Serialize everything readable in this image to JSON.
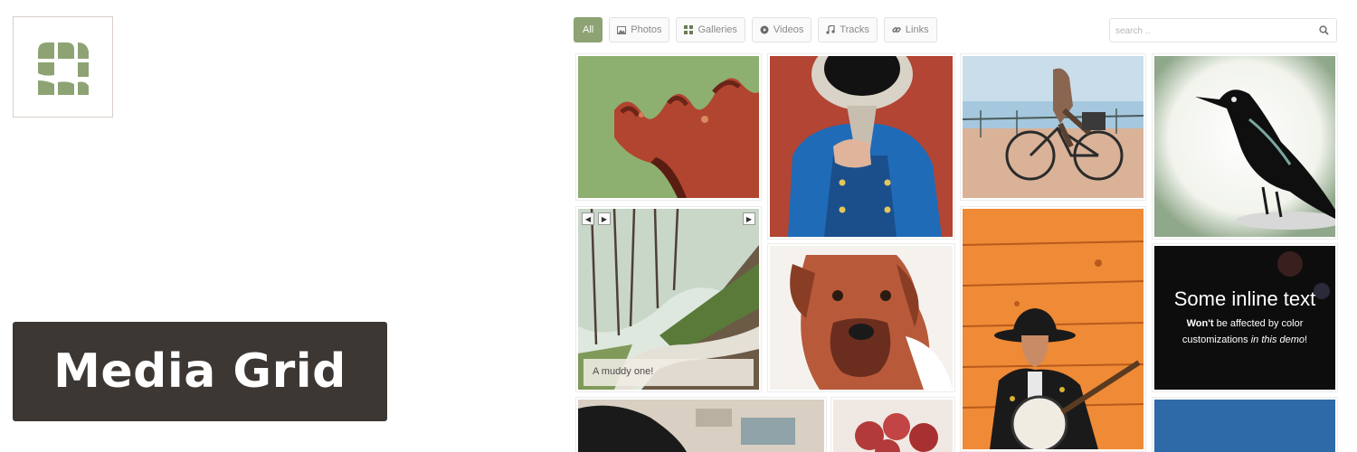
{
  "brand": {
    "title": "Media Grid",
    "logo_icon": "grid-of-rounded-squares-icon",
    "logo_color": "#8ea373",
    "plate_color": "#3c3733"
  },
  "filters": {
    "items": [
      {
        "label": "All",
        "icon": "",
        "active": true
      },
      {
        "label": "Photos",
        "icon": "photo-icon",
        "active": false
      },
      {
        "label": "Galleries",
        "icon": "galleries-icon",
        "active": false
      },
      {
        "label": "Videos",
        "icon": "play-icon",
        "active": false
      },
      {
        "label": "Tracks",
        "icon": "music-note-icon",
        "active": false
      },
      {
        "label": "Links",
        "icon": "link-icon",
        "active": false
      }
    ],
    "accent_color": "#8ea373"
  },
  "search": {
    "placeholder": "search ..",
    "icon": "search-icon"
  },
  "grid": {
    "tiles": [
      {
        "subject": "crown-sculpture"
      },
      {
        "subject": "trumpet-player"
      },
      {
        "subject": "cyclist"
      },
      {
        "subject": "blackbird"
      },
      {
        "subject": "forest-path-gallery",
        "caption": "A muddy one!"
      },
      {
        "subject": "boxer-dog"
      },
      {
        "subject": "banjo-player"
      },
      {
        "subject": "inline-text-block",
        "inline_title": "Some inline text",
        "inline_bold": "Won't",
        "inline_mid": " be affected by color customizations ",
        "inline_italic": "in this demo",
        "inline_end": "!"
      },
      {
        "subject": "blurred-photo"
      },
      {
        "subject": "raspberries"
      },
      {
        "subject": "blue-tile"
      }
    ]
  }
}
